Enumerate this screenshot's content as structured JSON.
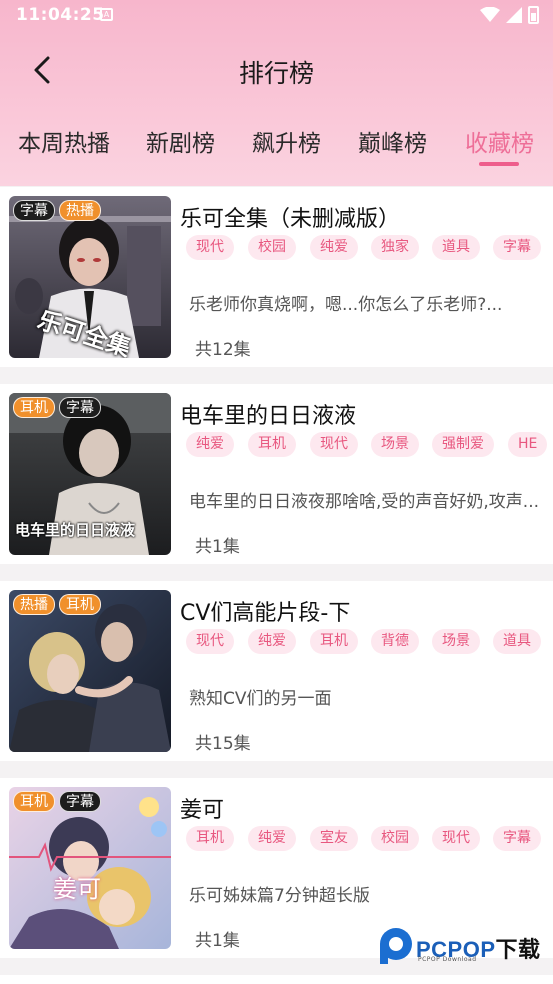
{
  "status_bar": {
    "time": "11:04:25",
    "notif_icon": "A"
  },
  "header": {
    "title": "排行榜"
  },
  "tabs": [
    {
      "label": "本周热播",
      "active": false
    },
    {
      "label": "新剧榜",
      "active": false
    },
    {
      "label": "飙升榜",
      "active": false
    },
    {
      "label": "巅峰榜",
      "active": false
    },
    {
      "label": "收藏榜",
      "active": true
    }
  ],
  "colors": {
    "accent": "#ee6f98",
    "tag_bg": "#fde8ef",
    "tag_text": "#e8577f",
    "header_pink": "#f7b6cc",
    "badge_orange": "#f0902c"
  },
  "items": [
    {
      "badges": [
        "字幕",
        "热播"
      ],
      "cover_text": "乐可全集",
      "title": "乐可全集（未删减版）",
      "tags": [
        "现代",
        "校园",
        "纯爱",
        "独家",
        "道具",
        "字幕"
      ],
      "desc": "乐老师你真烧啊，嗯...你怎么了乐老师?...",
      "episodes": "共12集"
    },
    {
      "badges": [
        "耳机",
        "字幕"
      ],
      "cover_text": "电车里的日日液液",
      "title": "电车里的日日液液",
      "tags": [
        "纯爱",
        "耳机",
        "现代",
        "场景",
        "强制爱",
        "HE"
      ],
      "desc": "电车里的日日液夜那啥啥,受的声音好奶,攻声...",
      "episodes": "共1集"
    },
    {
      "badges": [
        "热播",
        "耳机"
      ],
      "cover_text": "",
      "title": "CV们高能片段-下",
      "tags": [
        "现代",
        "纯爱",
        "耳机",
        "背德",
        "场景",
        "道具"
      ],
      "desc": "熟知CV们的另一面",
      "episodes": "共15集"
    },
    {
      "badges": [
        "耳机",
        "字幕"
      ],
      "cover_text": "姜可",
      "title": "姜可",
      "tags": [
        "耳机",
        "纯爱",
        "室友",
        "校园",
        "现代",
        "字幕"
      ],
      "desc": "乐可姊妹篇7分钟超长版",
      "episodes": "共1集"
    }
  ],
  "watermark": {
    "brand_a": "PCPOP",
    "brand_b": "下载",
    "sub": "PCPOP Download"
  }
}
